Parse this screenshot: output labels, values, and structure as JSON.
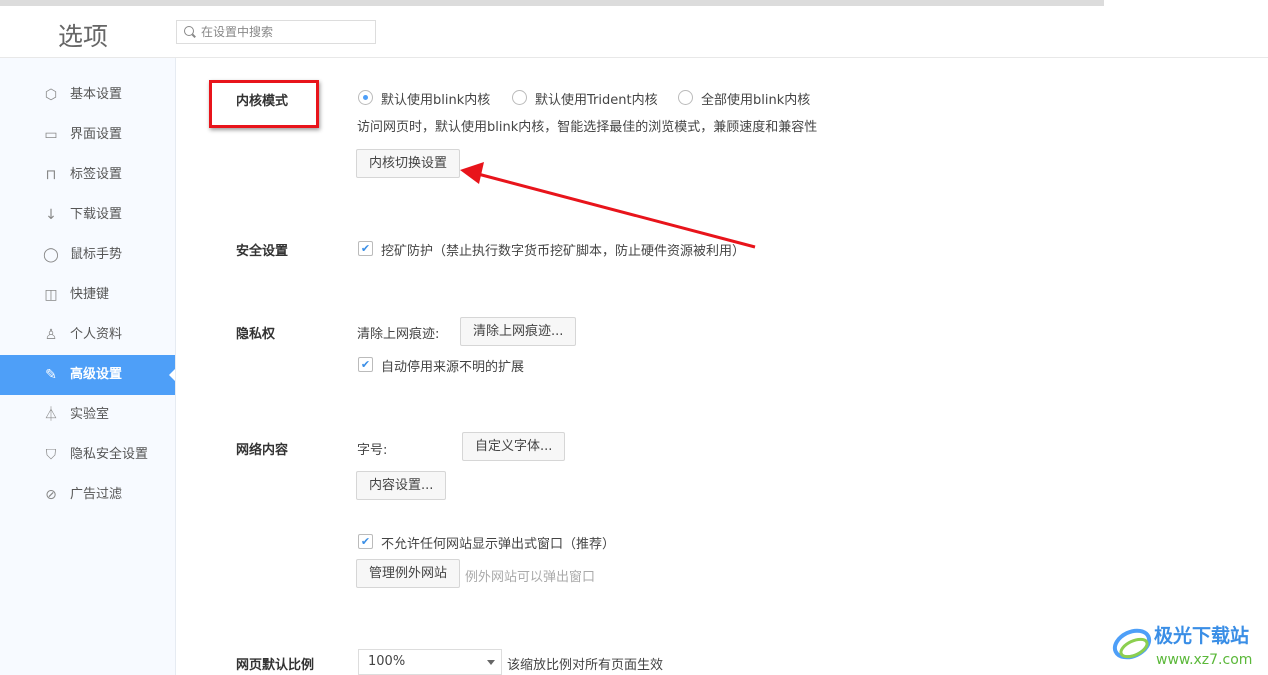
{
  "header": {
    "title": "选项",
    "search_placeholder": "在设置中搜索"
  },
  "sidebar": {
    "items": [
      {
        "label": "基本设置",
        "icon": "gear-icon"
      },
      {
        "label": "界面设置",
        "icon": "window-icon"
      },
      {
        "label": "标签设置",
        "icon": "tab-icon"
      },
      {
        "label": "下载设置",
        "icon": "download-icon"
      },
      {
        "label": "鼠标手势",
        "icon": "mouse-icon"
      },
      {
        "label": "快捷键",
        "icon": "keyboard-icon"
      },
      {
        "label": "个人资料",
        "icon": "user-icon"
      },
      {
        "label": "高级设置",
        "icon": "wrench-icon",
        "active": true
      },
      {
        "label": "实验室",
        "icon": "flask-icon"
      },
      {
        "label": "隐私安全设置",
        "icon": "shield-icon"
      },
      {
        "label": "广告过滤",
        "icon": "block-icon"
      }
    ]
  },
  "kernel": {
    "label": "内核模式",
    "options": [
      "默认使用blink内核",
      "默认使用Trident内核",
      "全部使用blink内核"
    ],
    "selected": 0,
    "desc": "访问网页时，默认使用blink内核，智能选择最佳的浏览模式，兼顾速度和兼容性",
    "button": "内核切换设置"
  },
  "security": {
    "label": "安全设置",
    "mining_protection": "挖矿防护（禁止执行数字货币挖矿脚本，防止硬件资源被利用）",
    "mining_checked": true
  },
  "privacy": {
    "label": "隐私权",
    "clear_label": "清除上网痕迹:",
    "clear_button": "清除上网痕迹...",
    "auto_disable": "自动停用来源不明的扩展",
    "auto_disable_checked": true
  },
  "web_content": {
    "label": "网络内容",
    "font_size_label": "字号:",
    "custom_font_button": "自定义字体...",
    "content_settings_button": "内容设置...",
    "block_popups": "不允许任何网站显示弹出式窗口（推荐）",
    "block_popups_checked": true,
    "manage_exceptions_button": "管理例外网站",
    "exceptions_hint": "例外网站可以弹出窗口"
  },
  "zoom": {
    "label": "网页默认比例",
    "value": "100%",
    "hint": "该缩放比例对所有页面生效"
  },
  "watermark": {
    "name": "极光下载站",
    "url": "www.xz7.com"
  },
  "colors": {
    "accent": "#4e9ff8",
    "annotation": "#e8141b"
  }
}
